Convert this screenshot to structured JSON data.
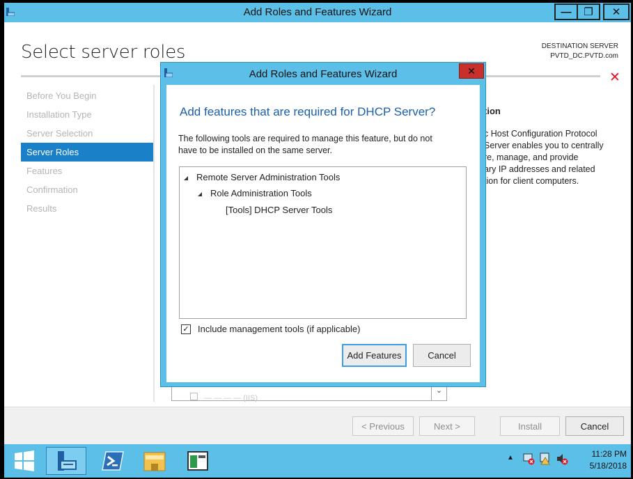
{
  "window": {
    "title": "Add Roles and Features Wizard",
    "minimize_glyph": "—",
    "maximize_glyph": "❐",
    "close_glyph": "✕"
  },
  "page": {
    "title": "Select server roles",
    "destination_label": "DESTINATION SERVER",
    "destination_server": "PVTD_DC.PVTD.com"
  },
  "nav": {
    "items": [
      {
        "label": "Before You Begin"
      },
      {
        "label": "Installation Type"
      },
      {
        "label": "Server Selection"
      },
      {
        "label": "Server Roles"
      },
      {
        "label": "Features"
      },
      {
        "label": "Confirmation"
      },
      {
        "label": "Results"
      }
    ],
    "active_index": 3
  },
  "description": {
    "heading": "tion",
    "lines": [
      "c Host Configuration Protocol",
      "Server enables you to centrally",
      "re, manage, and provide",
      "ary IP addresses and related",
      "tion for client computers."
    ]
  },
  "underlying_list": {
    "partial_item": "— — — — (IIS)"
  },
  "dialog": {
    "title": "Add Roles and Features Wizard",
    "close_glyph": "✕",
    "heading": "Add features that are required for DHCP Server?",
    "text_line1": "The following tools are required to manage this feature, but do not",
    "text_line2": "have to be installed on the same server.",
    "tree": [
      {
        "label": "Remote Server Administration Tools"
      },
      {
        "label": "Role Administration Tools"
      },
      {
        "label": "[Tools] DHCP Server Tools"
      }
    ],
    "include_checked": true,
    "include_check_glyph": "✓",
    "include_label": "Include management tools (if applicable)",
    "add_button": "Add Features",
    "cancel_button": "Cancel"
  },
  "bottom": {
    "previous": "< Previous",
    "next": "Next >",
    "install": "Install",
    "cancel": "Cancel"
  },
  "taskbar": {
    "items": [
      "start-icon",
      "server-manager-icon",
      "powershell-icon",
      "file-explorer-icon",
      "wizard-window-icon"
    ],
    "tray_arrow": "▲",
    "time": "11:28 PM",
    "date": "5/18/2018"
  },
  "colors": {
    "accent": "#5bbfe8",
    "nav_active": "#1a80c8",
    "heading_blue": "#1a5fa8",
    "close_red": "#c9302c",
    "warning_red": "#e81123"
  }
}
